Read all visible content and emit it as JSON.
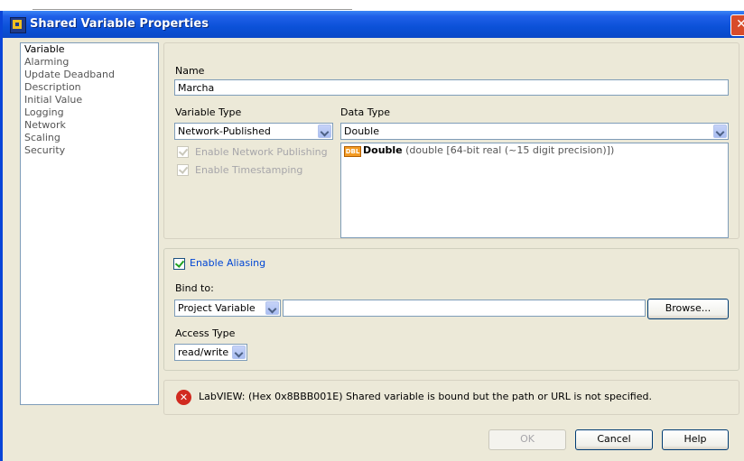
{
  "window": {
    "title": "Shared Variable Properties",
    "close_glyph": "✕"
  },
  "categories": [
    "Variable",
    "Alarming",
    "Update Deadband",
    "Description",
    "Initial Value",
    "Logging",
    "Network",
    "Scaling",
    "Security"
  ],
  "name": {
    "label": "Name",
    "value": "Marcha"
  },
  "variable_type": {
    "label": "Variable Type",
    "value": "Network-Published"
  },
  "data_type": {
    "label": "Data Type",
    "value": "Double",
    "item_icon_text": "DBL",
    "item_name": "Double",
    "item_desc": "(double [64-bit real (~15 digit precision)])"
  },
  "enable_network_publishing": {
    "label": "Enable Network Publishing",
    "checked": true,
    "disabled": true
  },
  "enable_timestamping": {
    "label": "Enable Timestamping",
    "checked": true,
    "disabled": true
  },
  "aliasing": {
    "label": "Enable Aliasing",
    "checked": true,
    "bind_to_label": "Bind to:",
    "bind_type": "Project Variable",
    "path_value": "",
    "browse_label": "Browse...",
    "access_type_label": "Access Type",
    "access_type": "read/write"
  },
  "error": {
    "message": "LabVIEW:  (Hex 0x8BBB001E) Shared variable is bound but the path or URL is not specified."
  },
  "buttons": {
    "ok": "OK",
    "cancel": "Cancel",
    "help": "Help"
  },
  "colors": {
    "title_bar": "#0b51d8",
    "dialog_bg": "#ece9d8",
    "error_icon": "#d12a1f",
    "alias_label": "#0046d5"
  }
}
